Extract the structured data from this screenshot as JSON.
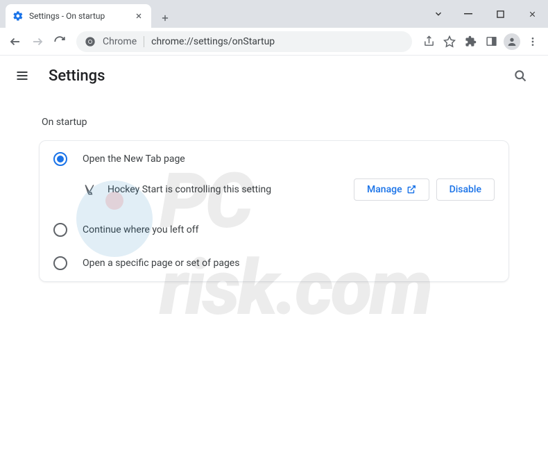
{
  "tab": {
    "title": "Settings - On startup"
  },
  "omnibox": {
    "scheme_label": "Chrome",
    "url": "chrome://settings/onStartup"
  },
  "settings": {
    "title": "Settings"
  },
  "section": {
    "title": "On startup"
  },
  "options": {
    "new_tab": "Open the New Tab page",
    "continue": "Continue where you left off",
    "specific": "Open a specific page or set of pages"
  },
  "extension": {
    "message": "Hockey Start is controlling this setting",
    "manage": "Manage",
    "disable": "Disable"
  },
  "watermark": {
    "top": "PC",
    "bot": "risk.com"
  }
}
